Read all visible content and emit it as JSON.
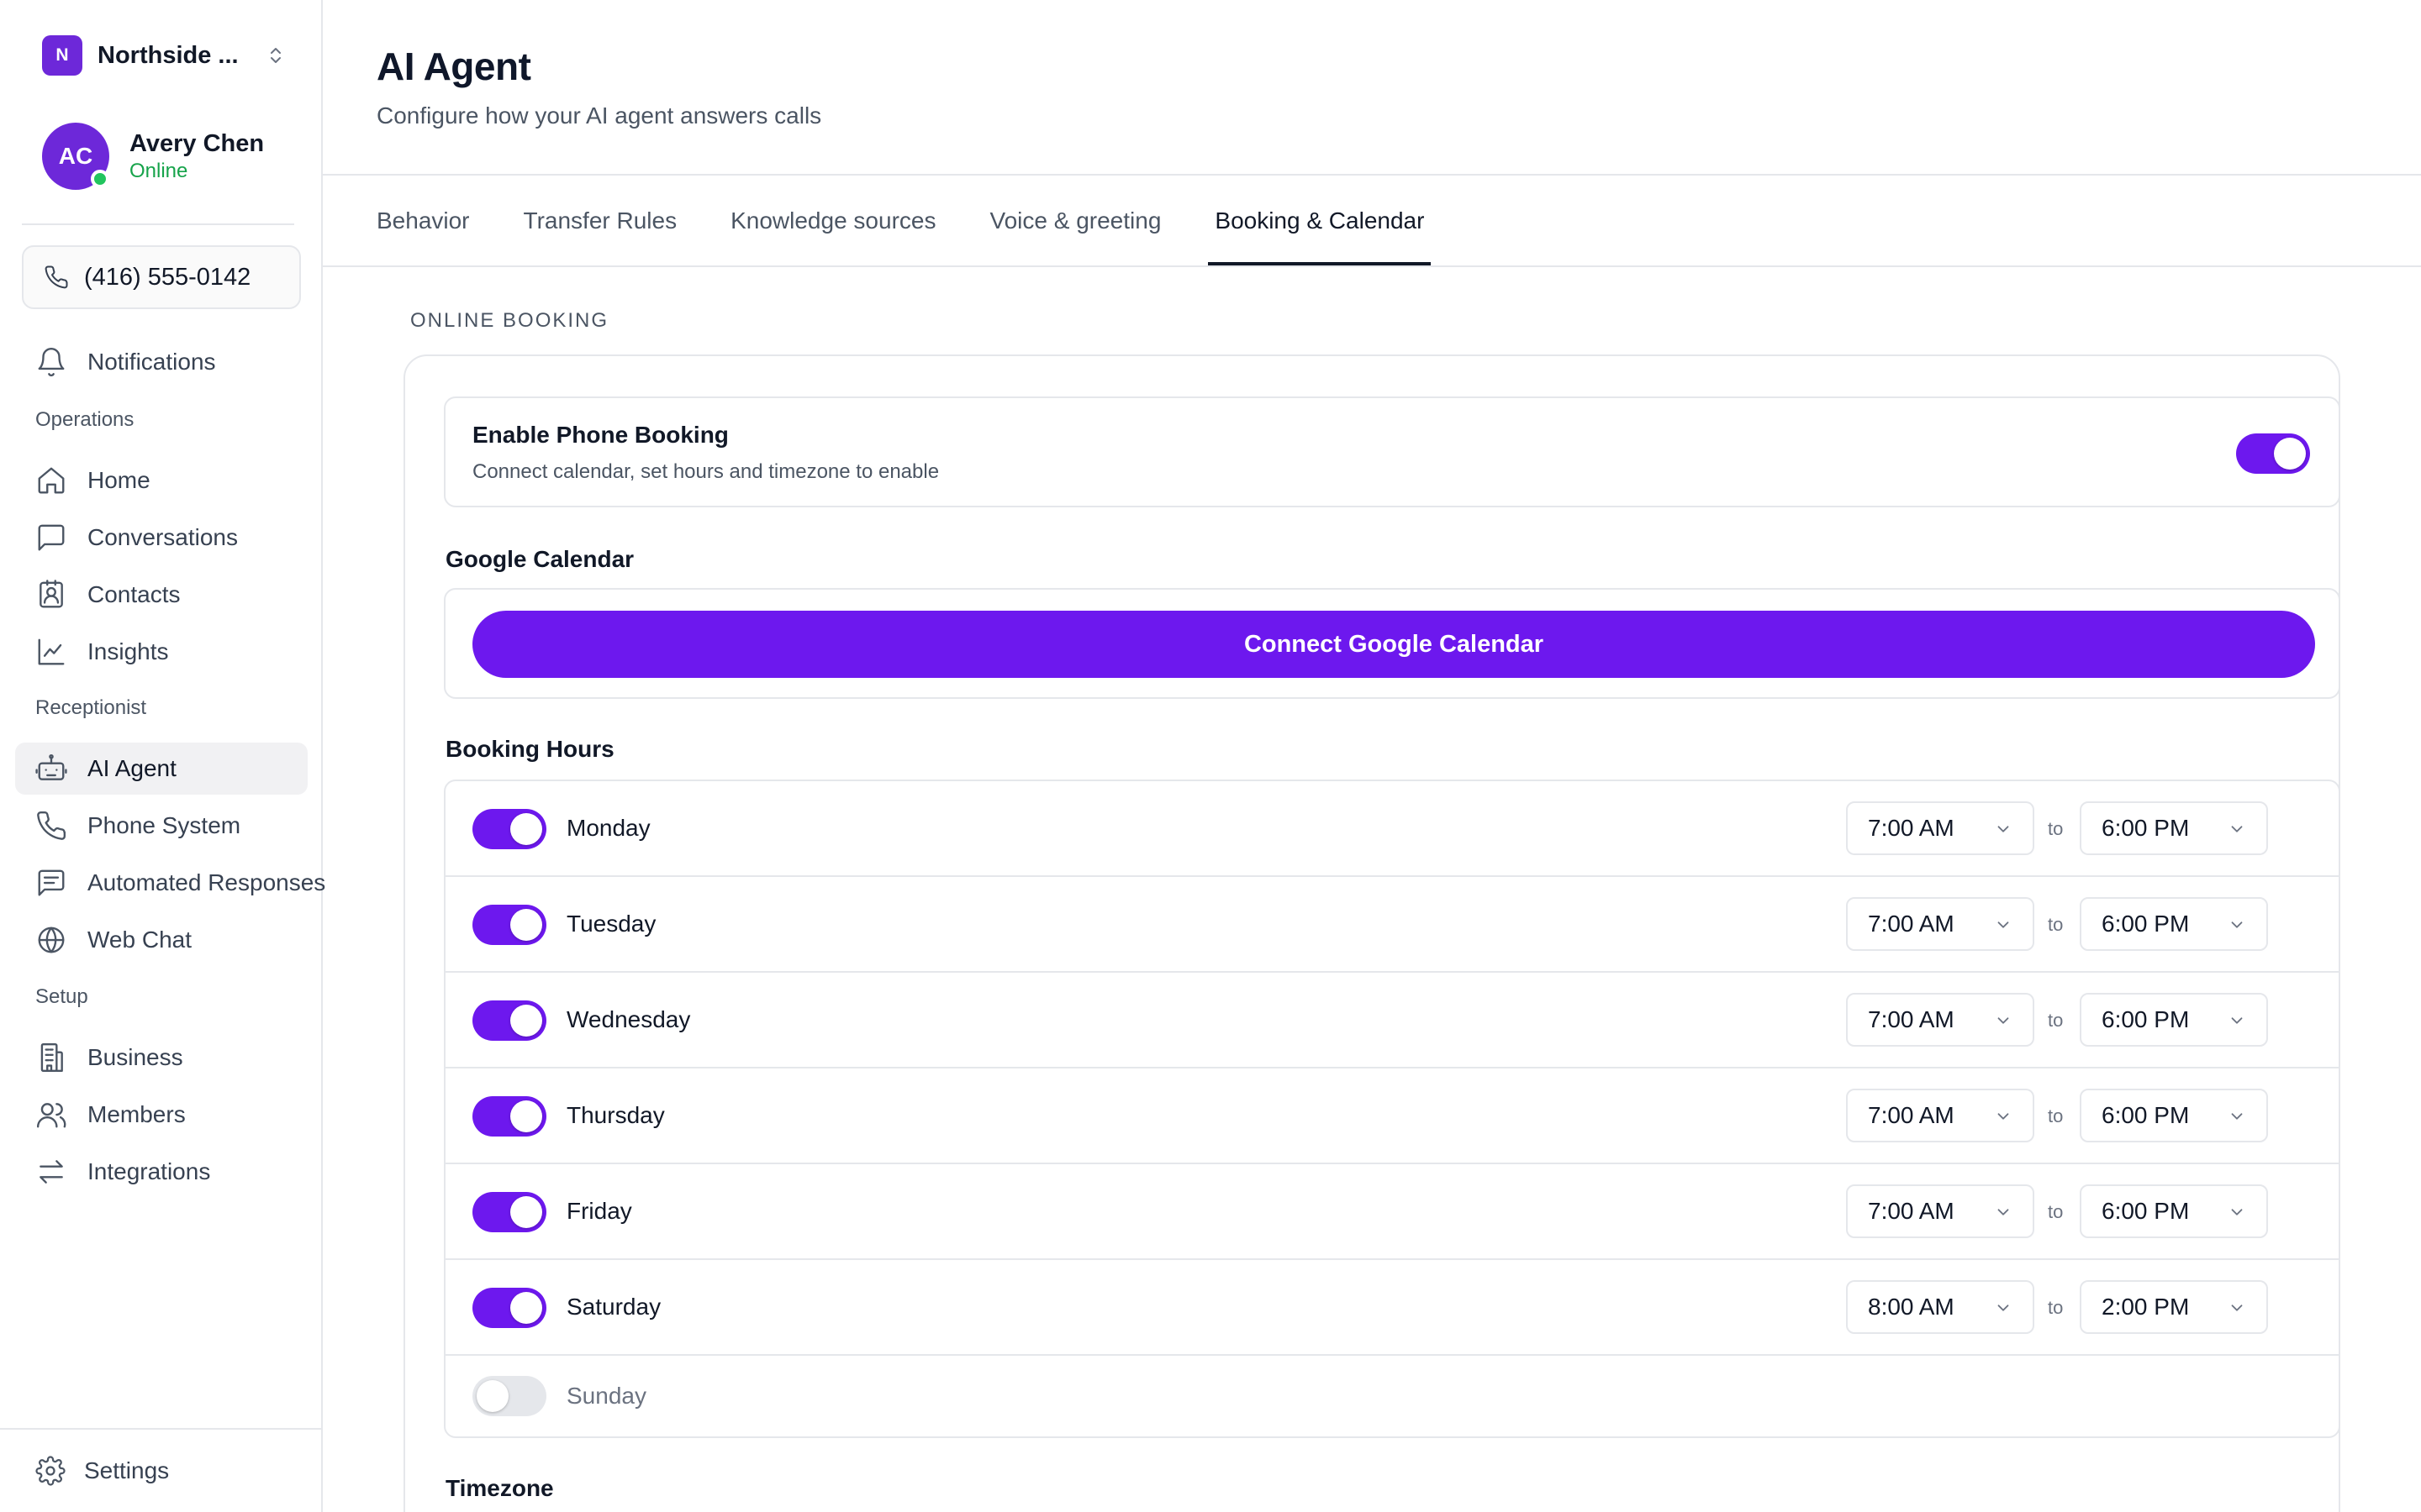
{
  "sidebar": {
    "org": {
      "badge": "N",
      "name": "Northside ..."
    },
    "profile": {
      "initials": "AC",
      "name": "Avery Chen",
      "status": "Online"
    },
    "phone": "(416) 555-0142",
    "notifications": "Notifications",
    "sections": {
      "operations": "Operations",
      "receptionist": "Receptionist",
      "setup": "Setup"
    },
    "items": {
      "home": "Home",
      "conversations": "Conversations",
      "contacts": "Contacts",
      "insights": "Insights",
      "ai_agent": "AI Agent",
      "phone_system": "Phone System",
      "automated_responses": "Automated Responses",
      "web_chat": "Web Chat",
      "business": "Business",
      "members": "Members",
      "integrations": "Integrations"
    },
    "settings": "Settings"
  },
  "header": {
    "title": "AI Agent",
    "subtitle": "Configure how your AI agent answers calls"
  },
  "tabs": [
    "Behavior",
    "Transfer Rules",
    "Knowledge sources",
    "Voice & greeting",
    "Booking & Calendar"
  ],
  "active_tab": "Booking & Calendar",
  "online_booking": {
    "section_label": "ONLINE BOOKING",
    "enable_title": "Enable Phone Booking",
    "enable_desc": "Connect calendar, set hours and timezone to enable",
    "enabled": true
  },
  "google_calendar": {
    "label": "Google Calendar",
    "button": "Connect Google Calendar"
  },
  "booking_hours": {
    "label": "Booking Hours",
    "to_label": "to",
    "days": [
      {
        "name": "Monday",
        "enabled": true,
        "start": "7:00 AM",
        "end": "6:00 PM"
      },
      {
        "name": "Tuesday",
        "enabled": true,
        "start": "7:00 AM",
        "end": "6:00 PM"
      },
      {
        "name": "Wednesday",
        "enabled": true,
        "start": "7:00 AM",
        "end": "6:00 PM"
      },
      {
        "name": "Thursday",
        "enabled": true,
        "start": "7:00 AM",
        "end": "6:00 PM"
      },
      {
        "name": "Friday",
        "enabled": true,
        "start": "7:00 AM",
        "end": "6:00 PM"
      },
      {
        "name": "Saturday",
        "enabled": true,
        "start": "8:00 AM",
        "end": "2:00 PM"
      },
      {
        "name": "Sunday",
        "enabled": false
      }
    ]
  },
  "timezone": {
    "label": "Timezone"
  },
  "colors": {
    "accent": "#6d18ee",
    "brand_badge": "#6d28d9",
    "online": "#22c55e"
  }
}
